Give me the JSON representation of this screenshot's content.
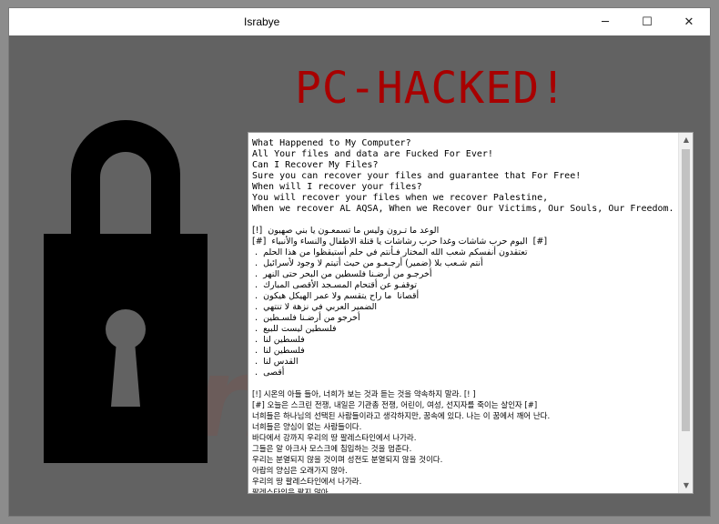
{
  "window": {
    "title": "Israbye",
    "controls": {
      "minimize": "─",
      "maximize": "☐",
      "close": "✕"
    }
  },
  "headline": "PC-HACKED!",
  "icons": {
    "lock": "padlock-icon"
  },
  "colors": {
    "headline": "#a80000",
    "background": "#626262"
  },
  "note": {
    "lines": [
      {
        "text": "What Happened to My Computer?",
        "script": "en"
      },
      {
        "text": "All Your files and data are Fucked For Ever!",
        "script": "en"
      },
      {
        "text": "Can I Recover My Files?",
        "script": "en"
      },
      {
        "text": "Sure you can recover your files and guarantee that For Free!",
        "script": "en"
      },
      {
        "text": "When will I recover your files?",
        "script": "en"
      },
      {
        "text": "You will recover your files when we recover Palestine,",
        "script": "en"
      },
      {
        "text": "When we recover AL AQSA, When we Recover Our Victims, Our Souls, Our Freedom.",
        "script": "en"
      },
      {
        "text": "",
        "script": "en"
      },
      {
        "text": "[!]  الوعد ما تـرون وليس ما تسمعـون يا بني صهيون",
        "script": "ar"
      },
      {
        "text": "[#]  اليوم حرب شاشات وغدا حرب رشاشات يا قتلة الاطفال والنساء والأنبياء  [#]",
        "script": "ar"
      },
      {
        "text": " .  تعتقدون أنفسكم شعب الله المختار فـأنتم في حلم أستيقظوا من هذا الحلم",
        "script": "ar"
      },
      {
        "text": " .  أنتم شـعب بلا (ضمير) أرجـعـو من حيث أتيتم لا وجود لأسرائيل",
        "script": "ar"
      },
      {
        "text": " .  أخرجـو من أرضـنا فلسطين من البحر حتى النهر",
        "script": "ar"
      },
      {
        "text": " .  توقفـو عن أقتحام المسـجد الأقصى المبارك",
        "script": "ar"
      },
      {
        "text": " .  أقصانا  ما راح يتقسم ولا عمر الهيكل هيكون",
        "script": "ar"
      },
      {
        "text": " .  الضمير العربي في نزهة لا تنتهي",
        "script": "ar"
      },
      {
        "text": " .  أخرجو من أرضـنا فلسـطين",
        "script": "ar"
      },
      {
        "text": " .  فلسطين ليست للبيع",
        "script": "ar"
      },
      {
        "text": " .  فلسطين لنا",
        "script": "ar"
      },
      {
        "text": " .  فلسطين لنا",
        "script": "ar"
      },
      {
        "text": " .  القدس لنا",
        "script": "ar"
      },
      {
        "text": " .  أقصى",
        "script": "ar"
      },
      {
        "text": "",
        "script": "en"
      },
      {
        "text": "[!] 시온의 아들 들아, 너희가 보는 것과 듣는 것을 약속하지 말라. [! ]",
        "script": "kr"
      },
      {
        "text": "[#] 오늘은 스크린 전쟁, 내일은 기관총 전쟁, 어린이, 여성, 선지자를 죽이는 살인자 [#]",
        "script": "kr"
      },
      {
        "text": "너희들은 하나님의 선택된 사람들이라고 생각하지만, 꿈속에 있다. 나는 이 꿈에서 깨어 난다.",
        "script": "kr"
      },
      {
        "text": "너희들은 양심이 없는 사람들이다.",
        "script": "kr"
      },
      {
        "text": "바다에서 강까지 우리의 땅 팔레스타인에서 나가라.",
        "script": "kr"
      },
      {
        "text": "그들은 알 아크사 모스크에 침입하는 것을 멈춘다.",
        "script": "kr"
      },
      {
        "text": "우리는 분열되지 않을 것이며 성전도 분열되지 않을 것이다.",
        "script": "kr"
      },
      {
        "text": "아랍의 양심은 오래가지 않아.",
        "script": "kr"
      },
      {
        "text": "우리의 땅 팔레스타인에서 나가라.",
        "script": "kr"
      },
      {
        "text": "팔레스타인은 팔지 않아.",
        "script": "kr"
      }
    ]
  }
}
